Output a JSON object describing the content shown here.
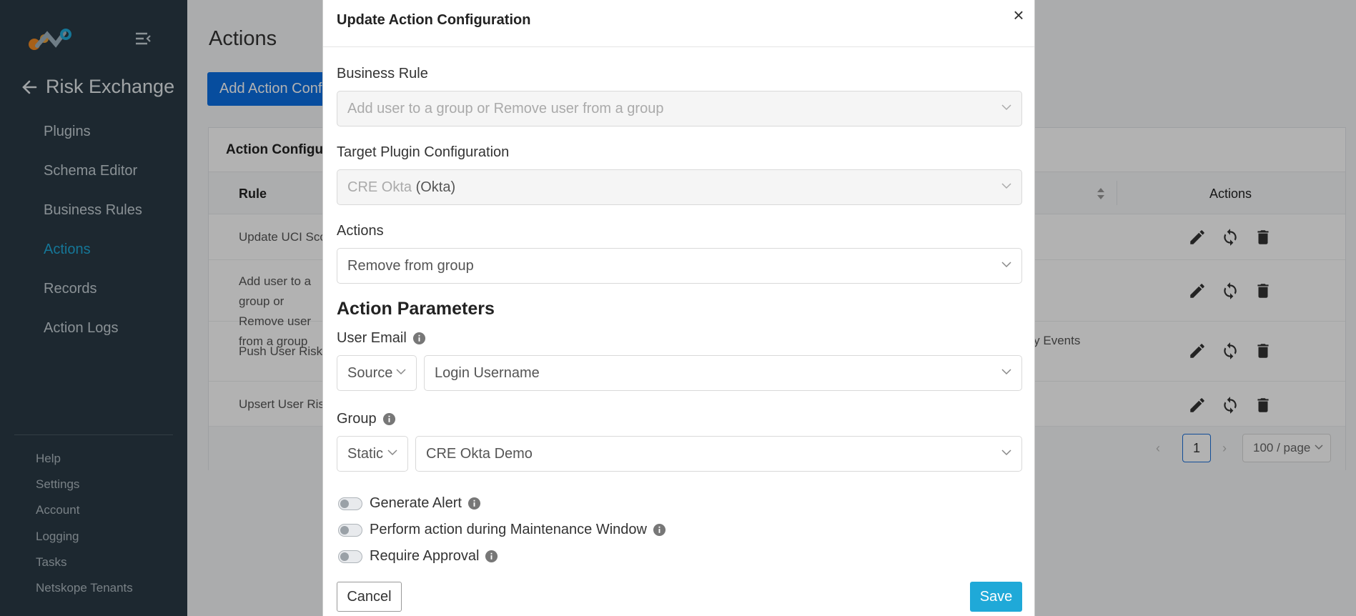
{
  "sidebar": {
    "section_title": "Risk Exchange",
    "items": [
      {
        "label": "Plugins"
      },
      {
        "label": "Schema Editor"
      },
      {
        "label": "Business Rules"
      },
      {
        "label": "Actions"
      },
      {
        "label": "Records"
      },
      {
        "label": "Action Logs"
      }
    ],
    "active_item": "Actions",
    "footer_items": [
      {
        "label": "Help"
      },
      {
        "label": "Settings"
      },
      {
        "label": "Account"
      },
      {
        "label": "Logging"
      },
      {
        "label": "Tasks"
      },
      {
        "label": "Netskope Tenants"
      }
    ]
  },
  "main": {
    "page_title": "Actions",
    "add_button_label": "Add Action Configuration",
    "card_title": "Action Configurations",
    "columns": {
      "rule": "Rule",
      "actions": "Actions"
    },
    "rows": [
      {
        "rule": "Update UCI Score",
        "extra": ""
      },
      {
        "rule": "Add user to a group or Remove user from a group",
        "extra": ""
      },
      {
        "rule": "Push User Risk",
        "extra": "rity Events"
      },
      {
        "rule": "Upsert User Risk",
        "extra": ""
      }
    ],
    "pagination": {
      "current_page": "1",
      "page_size": "100 / page"
    }
  },
  "modal": {
    "title": "Update Action Configuration",
    "close_label": "×",
    "business_rule": {
      "label": "Business Rule",
      "value": "Add user to a group or Remove user from a group"
    },
    "target_plugin": {
      "label": "Target Plugin Configuration",
      "value_name": "CRE Okta",
      "value_type": "(Okta)"
    },
    "actions": {
      "label": "Actions",
      "value": "Remove from group"
    },
    "params_heading": "Action Parameters",
    "user_email": {
      "label": "User Email",
      "source": "Source",
      "value": "Login Username"
    },
    "group": {
      "label": "Group",
      "source": "Static",
      "value": "CRE Okta Demo"
    },
    "toggles": [
      {
        "label": "Generate Alert",
        "on": false
      },
      {
        "label": "Perform action during Maintenance Window",
        "on": false
      },
      {
        "label": "Require Approval",
        "on": false
      }
    ],
    "cancel_label": "Cancel",
    "save_label": "Save"
  },
  "colors": {
    "sidebar_bg": "#2a3a45",
    "accent": "#1fa9d8",
    "primary_button": "#0b6fe3"
  }
}
